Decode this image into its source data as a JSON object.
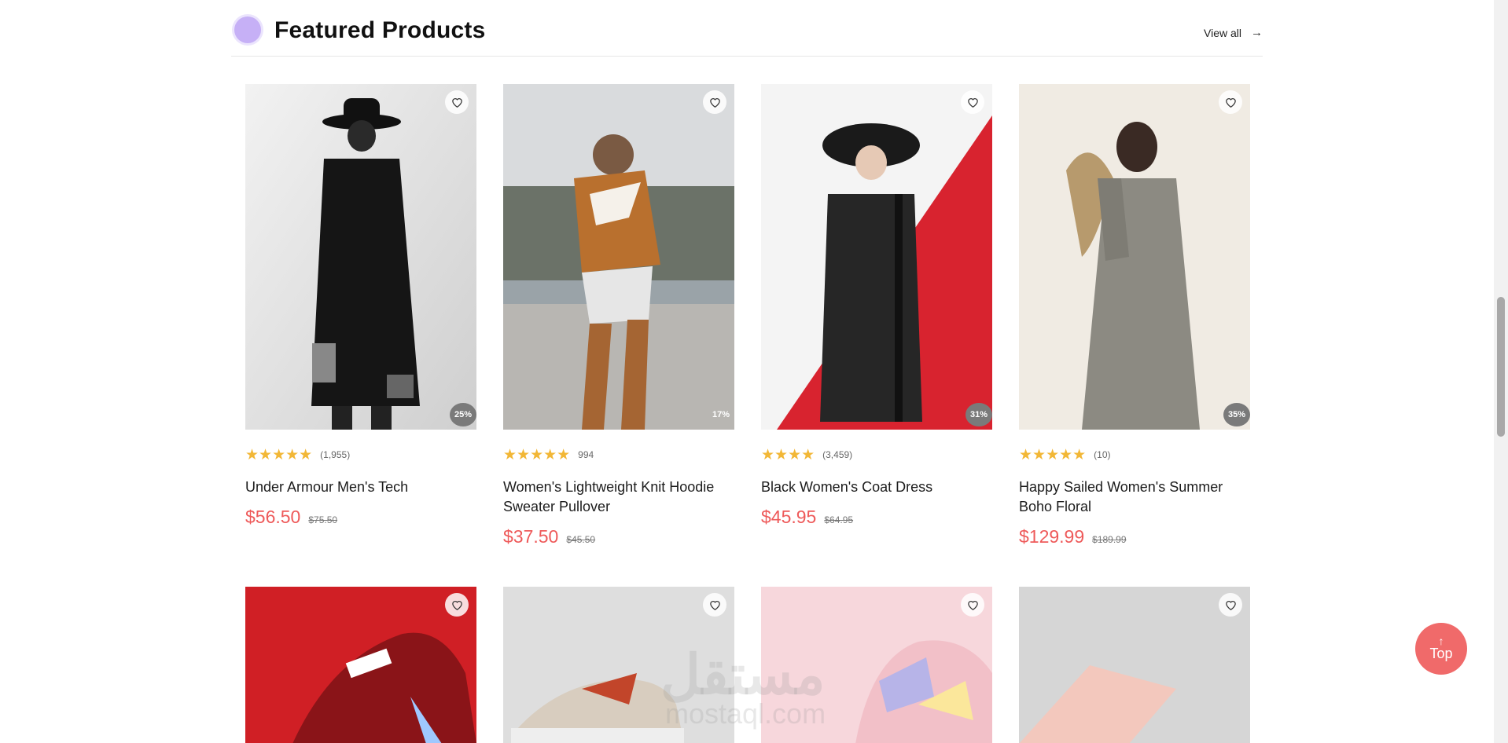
{
  "section": {
    "title": "Featured Products",
    "view_all": "View all"
  },
  "products": [
    {
      "name": "Under Armour Men's Tech",
      "rating_count": "(1,955)",
      "stars": "★★★★★",
      "discount": "25%",
      "price": "$56.50",
      "old_price": "$75.50"
    },
    {
      "name": "Women's Lightweight Knit Hoodie Sweater Pullover",
      "rating_count": "994",
      "stars": "★★★★★",
      "discount": "17%",
      "price": "$37.50",
      "old_price": "$45.50"
    },
    {
      "name": "Black Women's Coat Dress",
      "rating_count": "(3,459)",
      "stars": "★★★★",
      "discount": "31%",
      "price": "$45.95",
      "old_price": "$64.95"
    },
    {
      "name": "Happy Sailed Women's Summer Boho Floral",
      "rating_count": "(10)",
      "stars": "★★★★★",
      "discount": "35%",
      "price": "$129.99",
      "old_price": "$189.99"
    }
  ],
  "top_button": {
    "label": "Top"
  },
  "watermark": {
    "text": "مستقل",
    "domain": "mostaql.com"
  },
  "colors": {
    "accent": "#ee5a5a",
    "star": "#f2b736",
    "badge": "#7a7a7a",
    "dot": "#c6b0f6"
  },
  "icons": {
    "wishlist": "heart-outline-icon",
    "view_all": "arrow-right-icon",
    "top": "arrow-up-icon"
  }
}
